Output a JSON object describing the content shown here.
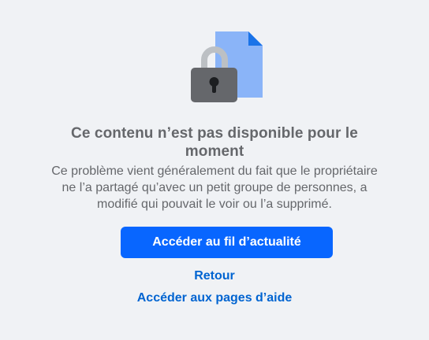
{
  "illustration": {
    "icon": "locked-document-icon",
    "colors": {
      "document": "#8ab4f8",
      "document_fold": "#1a73e8",
      "lock_body": "#65676b",
      "lock_shackle": "#bcc0c4",
      "keyhole": "#1c1e21"
    }
  },
  "content": {
    "title": "Ce contenu n’est pas disponible pour le moment",
    "description": "Ce problème vient généralement du fait que le propriétaire ne l’a partagé qu’avec un petit groupe de personnes, a modifié qui pouvait le voir ou l’a supprimé."
  },
  "actions": {
    "primary_label": "Accéder au fil d’actualité",
    "back_label": "Retour",
    "help_label": "Accéder aux pages d’aide"
  },
  "colors": {
    "background": "#f0f2f5",
    "primary": "#0866ff",
    "link": "#0064d1",
    "secondary_text": "#65676b"
  }
}
